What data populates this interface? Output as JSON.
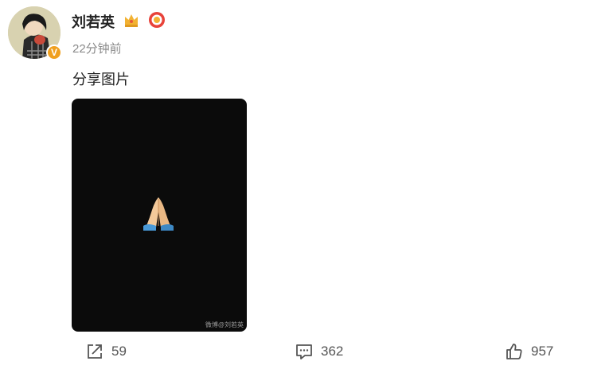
{
  "user": {
    "name": "刘若英",
    "verified_badge": "V",
    "badges": [
      "crown-icon",
      "medal-icon"
    ]
  },
  "post": {
    "time": "22分钟前",
    "text": "分享图片",
    "image": {
      "content": "folded-hands-emoji",
      "watermark": "微博@刘若英",
      "background": "#0b0b0b"
    }
  },
  "actions": {
    "repost": {
      "icon": "share-icon",
      "count": "59"
    },
    "comment": {
      "icon": "comment-icon",
      "count": "362"
    },
    "like": {
      "icon": "thumbs-up-icon",
      "count": "957"
    }
  },
  "colors": {
    "text": "#222222",
    "meta": "#8a8a8a",
    "badge": "#f0a020"
  }
}
